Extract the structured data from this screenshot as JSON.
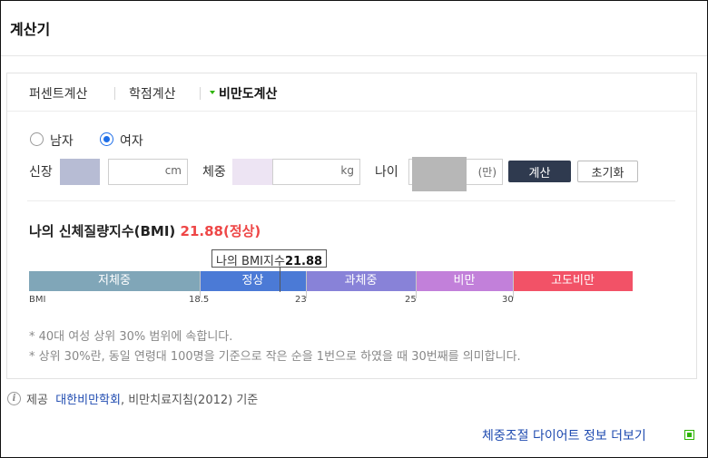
{
  "title": "계산기",
  "tabs": [
    {
      "label": "퍼센트계산",
      "active": false
    },
    {
      "label": "학점계산",
      "active": false
    },
    {
      "label": "비만도계산",
      "active": true
    }
  ],
  "gender": {
    "options": [
      {
        "label": "남자",
        "checked": false
      },
      {
        "label": "여자",
        "checked": true
      }
    ]
  },
  "fields": {
    "height": {
      "label": "신장",
      "unit": "cm",
      "value": ""
    },
    "weight": {
      "label": "체중",
      "unit": "kg",
      "value": ""
    },
    "age": {
      "label": "나이",
      "unit": "(만)",
      "value": ""
    }
  },
  "buttons": {
    "calculate": "계산",
    "reset": "초기화"
  },
  "result": {
    "prefix": "나의 신체질량지수(BMI)",
    "value": "21.88",
    "status": "(정상)"
  },
  "marker": {
    "label": "나의 BMI지수",
    "value": "21.88",
    "bmi": 21.88
  },
  "bmi_scale": {
    "min": 0,
    "max": 35,
    "axis_label": "BMI",
    "segments": [
      {
        "label": "저체중",
        "from": 0,
        "to": 18.5,
        "color": "#80a6b8"
      },
      {
        "label": "정상",
        "from": 18.5,
        "to": 23,
        "color": "#4b7ad6"
      },
      {
        "label": "과체중",
        "from": 23,
        "to": 25,
        "color": "#8882d8"
      },
      {
        "label": "비만",
        "from": 25,
        "to": 30,
        "color": "#c280da"
      },
      {
        "label": "고도비만",
        "from": 30,
        "to": 35,
        "color": "#f25267"
      }
    ],
    "ticks": [
      "18.5",
      "23",
      "25",
      "30"
    ]
  },
  "notes": [
    "* 40대 여성 상위 30% 범위에 속합니다.",
    "* 상위 30%란, 동일 연령대 100명을 기준으로 작은 순을 1번으로 하였을 때 30번째를 의미합니다."
  ],
  "source": {
    "prefix": "제공",
    "link": "대한비만학회",
    "suffix": ", 비만치료지침(2012) 기준"
  },
  "more_link": "체중조절 다이어트 정보 더보기",
  "colors": {
    "accent": "#2db400",
    "result": "#ee4646",
    "link": "#1f4bb0",
    "button": "#2f3a4f"
  }
}
